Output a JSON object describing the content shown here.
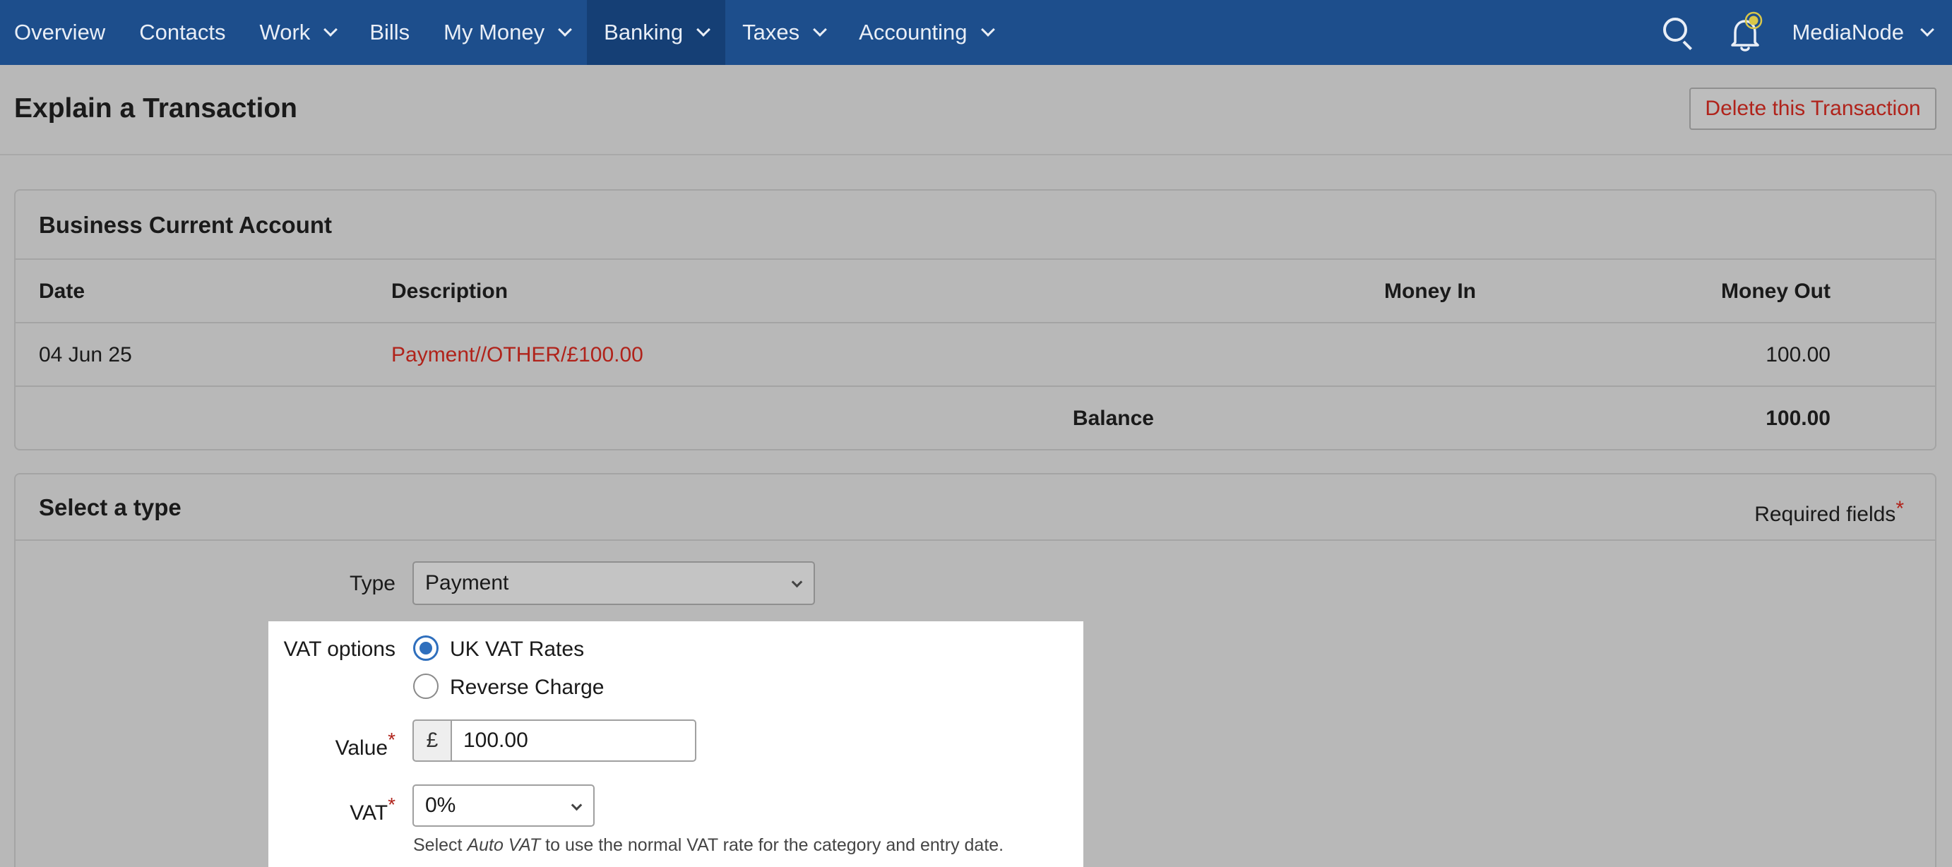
{
  "nav": {
    "items": [
      {
        "label": "Overview",
        "dropdown": false,
        "active": false
      },
      {
        "label": "Contacts",
        "dropdown": false,
        "active": false
      },
      {
        "label": "Work",
        "dropdown": true,
        "active": false
      },
      {
        "label": "Bills",
        "dropdown": false,
        "active": false
      },
      {
        "label": "My Money",
        "dropdown": true,
        "active": false
      },
      {
        "label": "Banking",
        "dropdown": true,
        "active": true
      },
      {
        "label": "Taxes",
        "dropdown": true,
        "active": false
      },
      {
        "label": "Accounting",
        "dropdown": true,
        "active": false
      }
    ],
    "account_name": "MediaNode"
  },
  "header": {
    "title": "Explain a Transaction",
    "delete_label": "Delete this Transaction"
  },
  "account": {
    "title": "Business Current Account",
    "columns": {
      "date": "Date",
      "description": "Description",
      "money_in": "Money In",
      "money_out": "Money Out"
    },
    "rows": [
      {
        "date": "04 Jun 25",
        "description": "Payment//OTHER/£100.00",
        "money_in": "",
        "money_out": "100.00"
      }
    ],
    "balance_label": "Balance",
    "balance_value": "100.00"
  },
  "form": {
    "title": "Select a type",
    "required_label": "Required fields",
    "required_star": "*",
    "type_label": "Type",
    "type_value": "Payment",
    "vat_options_label": "VAT options",
    "vat_options": [
      {
        "label": "UK VAT Rates",
        "selected": true
      },
      {
        "label": "Reverse Charge",
        "selected": false
      }
    ],
    "value_label": "Value",
    "currency_symbol": "£",
    "value": "100.00",
    "vat_label": "VAT",
    "vat_value": "0%",
    "hint_prefix": "Select ",
    "hint_em": "Auto VAT",
    "hint_suffix": " to use the normal VAT rate for the category and entry date."
  },
  "colors": {
    "nav_bg": "#1d4e8c",
    "nav_active": "#153f75",
    "accent_red": "#b0231b",
    "radio_blue": "#2f6fbd"
  }
}
